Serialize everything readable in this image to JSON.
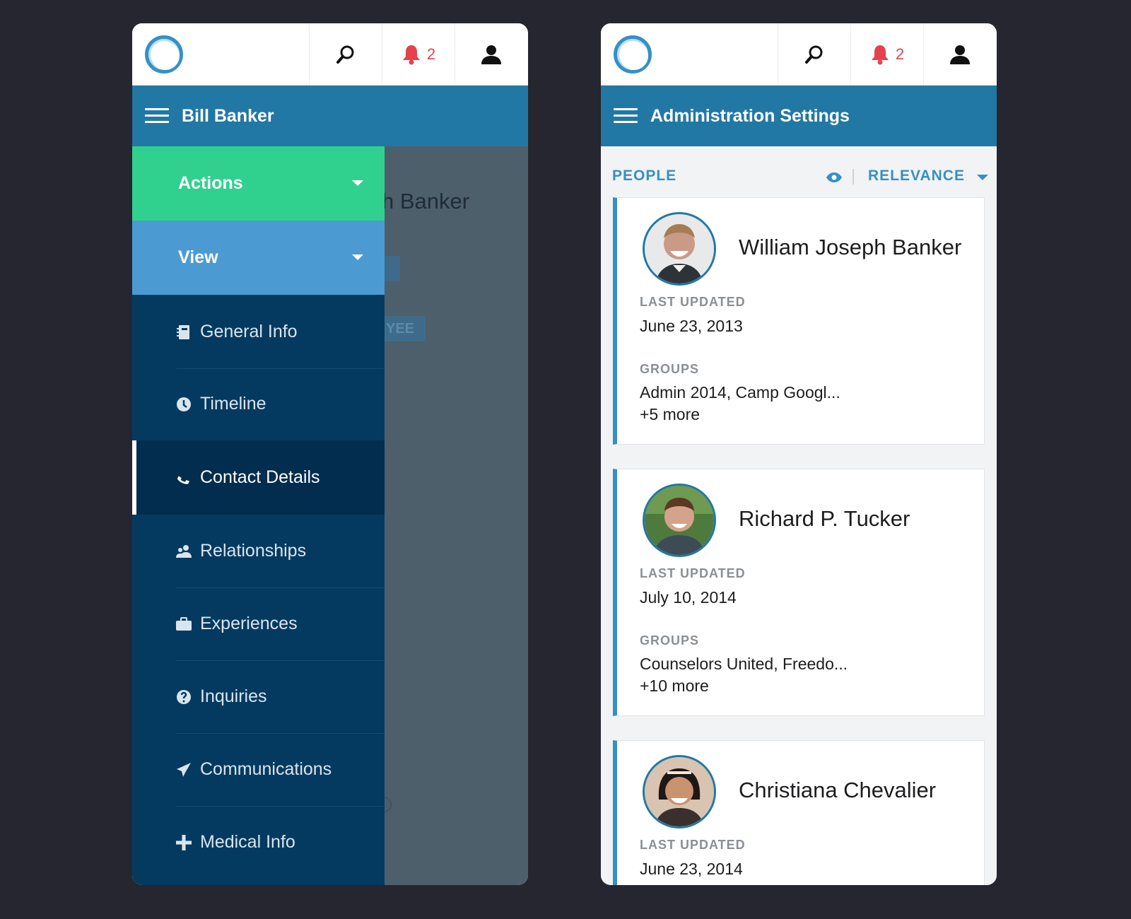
{
  "notifications_count": "2",
  "left_screen": {
    "title": "Bill Banker",
    "background_name": "h Banker",
    "background_badge": "YEE",
    "drawer": {
      "actions_label": "Actions",
      "view_label": "View",
      "items": [
        {
          "label": "General Info",
          "icon": "contact-card-icon"
        },
        {
          "label": "Timeline",
          "icon": "clock-icon"
        },
        {
          "label": "Contact Details",
          "icon": "phone-icon",
          "active": true
        },
        {
          "label": "Relationships",
          "icon": "people-icon"
        },
        {
          "label": "Experiences",
          "icon": "briefcase-icon"
        },
        {
          "label": "Inquiries",
          "icon": "question-icon"
        },
        {
          "label": "Communications",
          "icon": "send-icon"
        },
        {
          "label": "Medical Info",
          "icon": "plus-icon"
        }
      ]
    }
  },
  "right_screen": {
    "title": "Administration Settings",
    "filter_label": "PEOPLE",
    "sort_label": "RELEVANCE",
    "people": [
      {
        "name": "William Joseph Banker",
        "last_updated_label": "LAST UPDATED",
        "last_updated": "June 23, 2013",
        "groups_label": "GROUPS",
        "groups": "Admin 2014, Camp Googl...",
        "more": "+5 more"
      },
      {
        "name": "Richard P. Tucker",
        "last_updated_label": "LAST UPDATED",
        "last_updated": "July 10, 2014",
        "groups_label": "GROUPS",
        "groups": "Counselors United, Freedo...",
        "more": "+10 more"
      },
      {
        "name": "Christiana Chevalier",
        "last_updated_label": "LAST UPDATED",
        "last_updated": "June 23, 2014"
      }
    ]
  },
  "colors": {
    "accent_blue": "#2278a5",
    "actions_green": "#30d18f",
    "view_blue": "#4b9bd2",
    "drawer_navy": "#053a60",
    "notification_red": "#e5424d"
  }
}
